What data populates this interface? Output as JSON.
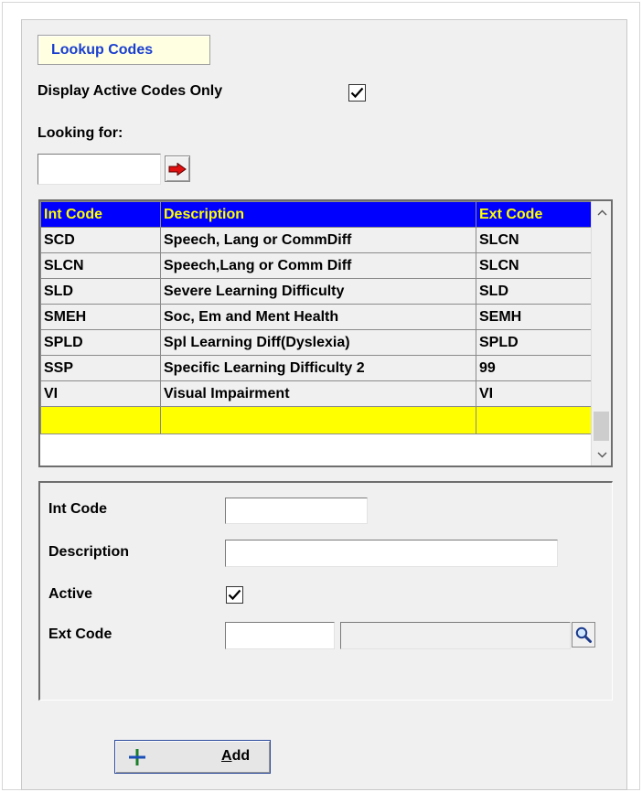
{
  "title": "Lookup Codes",
  "filter": {
    "active_only_label": "Display Active Codes Only",
    "active_only_checked": true,
    "looking_for_label": "Looking for:",
    "looking_for_value": ""
  },
  "grid": {
    "columns": [
      "Int Code",
      "Description",
      "Ext Code"
    ],
    "rows": [
      [
        "SCD",
        "Speech, Lang or CommDiff",
        "SLCN"
      ],
      [
        "SLCN",
        "Speech,Lang or Comm Diff",
        "SLCN"
      ],
      [
        "SLD",
        "Severe Learning Difficulty",
        "SLD"
      ],
      [
        "SMEH",
        "Soc, Em and Ment Health",
        "SEMH"
      ],
      [
        "SPLD",
        "Spl Learning Diff(Dyslexia)",
        "SPLD"
      ],
      [
        "SSP",
        "Specific Learning Difficulty 2",
        "99"
      ],
      [
        "VI",
        "Visual Impairment",
        "VI"
      ]
    ],
    "new_row": [
      "",
      "",
      ""
    ]
  },
  "detail": {
    "int_code_label": "Int Code",
    "int_code_value": "",
    "description_label": "Description",
    "description_value": "",
    "active_label": "Active",
    "active_checked": true,
    "ext_code_label": "Ext Code",
    "ext_code_value": "",
    "ext_code_desc_value": ""
  },
  "buttons": {
    "add_label_accel": "A",
    "add_label_rest": "dd",
    "go_icon": "red-arrow-icon",
    "lookup_icon": "magnifier-icon",
    "add_icon": "plus-icon"
  },
  "colors": {
    "grid_header_bg": "#0000ff",
    "grid_header_text": "#ffff00",
    "new_row_bg": "#ffff00",
    "title_text": "#1a3fd0"
  }
}
